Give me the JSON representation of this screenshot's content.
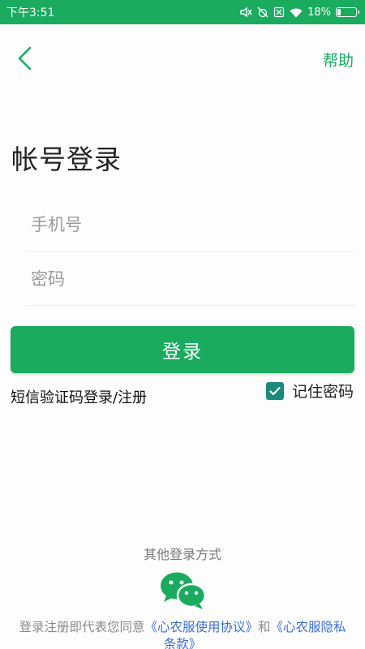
{
  "status_bar": {
    "time": "下午3:51",
    "battery": "18%",
    "battery_level": 0.18,
    "icons": [
      "mute-icon",
      "alarm-off-icon",
      "sim-off-icon",
      "wifi-icon",
      "battery-icon"
    ]
  },
  "header": {
    "help_label": "帮助"
  },
  "page_title": "帐号登录",
  "form": {
    "phone_placeholder": "手机号",
    "phone_value": "",
    "password_placeholder": "密码",
    "password_value": "",
    "login_label": "登录",
    "sms_login_label": "短信验证码登录/注册",
    "remember_label": "记住密码",
    "remember_checked": true
  },
  "other_login": {
    "label": "其他登录方式",
    "wechat_icon": "wechat-icon"
  },
  "agreement": {
    "prefix": "登录注册即代表您同意",
    "terms_link": "《心农服使用协议》",
    "and": "和",
    "privacy_link_line1": "《心农服隐私",
    "privacy_link_line2": "条款》"
  },
  "colors": {
    "primary": "#1aab5f",
    "checkbox": "#1a8a7a",
    "link": "#3b6fd6"
  }
}
